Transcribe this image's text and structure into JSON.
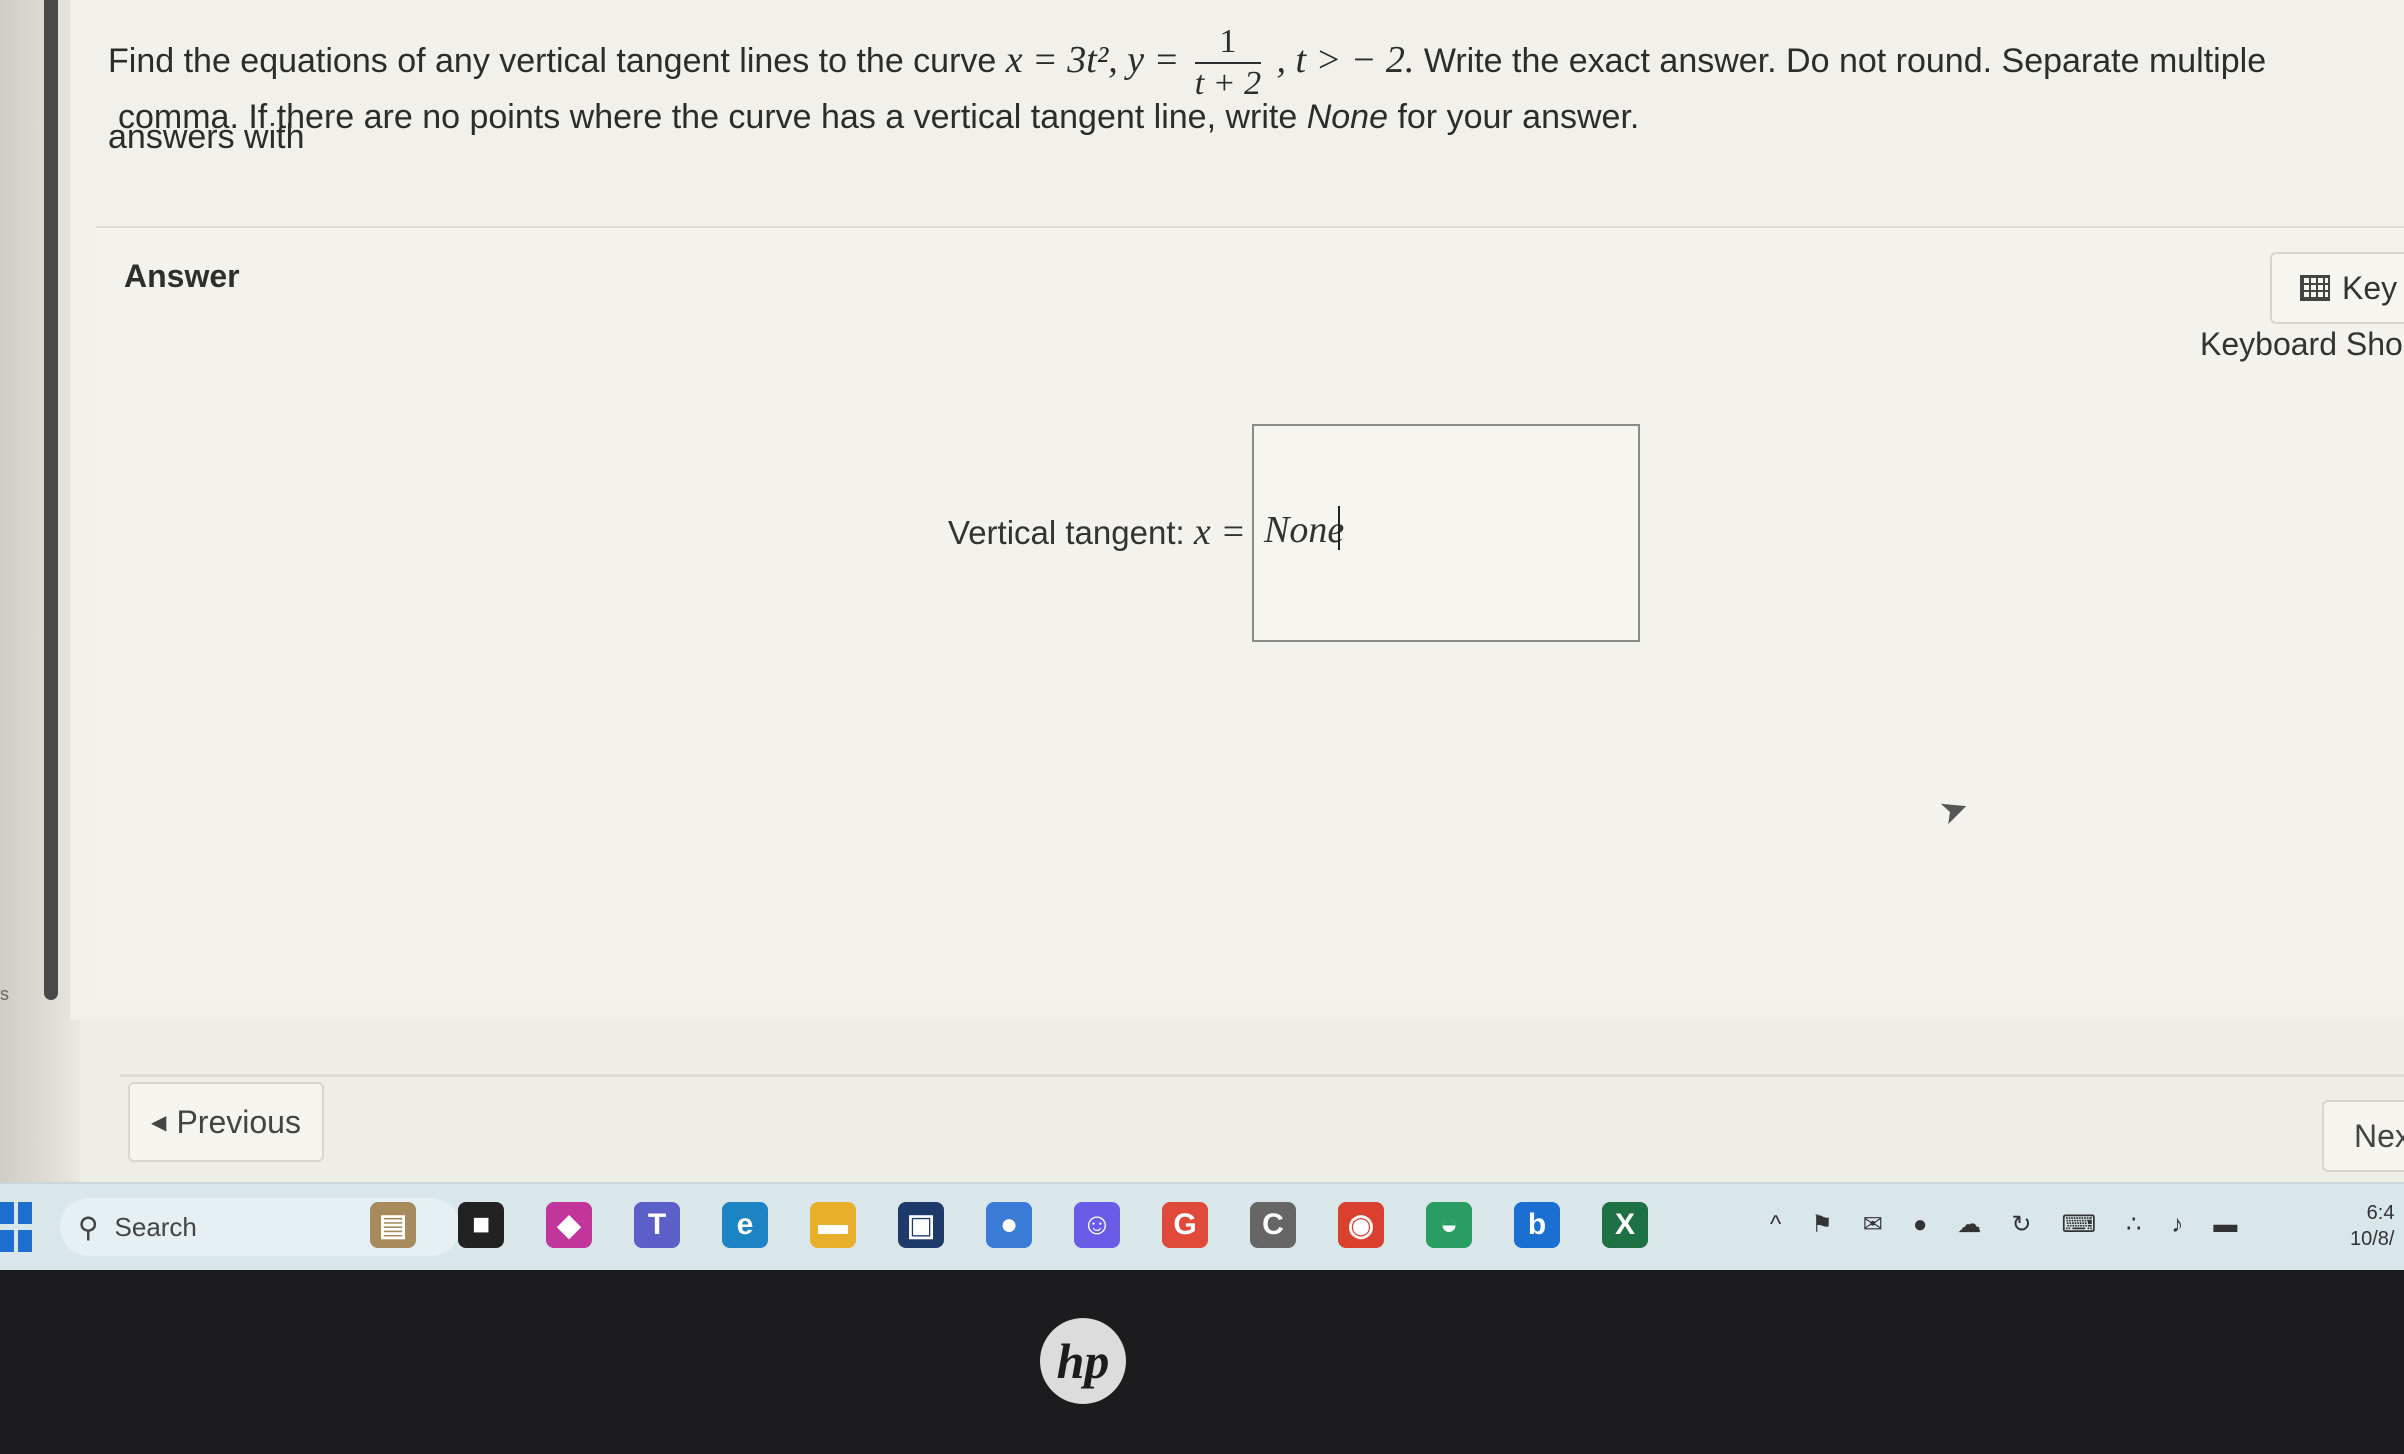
{
  "question": {
    "text_before": "Find the equations of any vertical tangent lines to the curve",
    "x_expr": "x = 3t², y =",
    "fraction_numerator": "1",
    "fraction_denominator": "t + 2",
    "condition": ", t > − 2.",
    "text_after": "Write the exact answer. Do not round. Separate multiple answers with",
    "line2": "comma. If there are no points where the curve has a vertical tangent line, write",
    "line2_emph": "None",
    "line2_end": "for your answer."
  },
  "answer": {
    "label": "Answer",
    "keypad_label": "Key",
    "keyboard_shortcuts": "Keyboard Shor",
    "vertical_tangent_label": "Vertical tangent:",
    "variable": "x =",
    "input_value": "None"
  },
  "navigation": {
    "previous": "Previous",
    "next": "Nex"
  },
  "taskbar": {
    "search_placeholder": "Search",
    "icons": [
      {
        "name": "widgets-icon",
        "glyph": "▤",
        "color": "#a88b5c"
      },
      {
        "name": "task-view-icon",
        "glyph": "■",
        "color": "#222222"
      },
      {
        "name": "copilot-icon",
        "glyph": "◆",
        "color": "#c2359b"
      },
      {
        "name": "teams-icon",
        "glyph": "T",
        "color": "#5b5fc7"
      },
      {
        "name": "edge-icon",
        "glyph": "e",
        "color": "#1d84c4"
      },
      {
        "name": "file-explorer-icon",
        "glyph": "▬",
        "color": "#e8b02a"
      },
      {
        "name": "store-icon",
        "glyph": "▣",
        "color": "#1e3a6a"
      },
      {
        "name": "copilot-app-icon",
        "glyph": "●",
        "color": "#3a7bd5"
      },
      {
        "name": "chat-icon",
        "glyph": "☺",
        "color": "#6b5ce7"
      },
      {
        "name": "google-icon",
        "glyph": "G",
        "color": "#e04a3a"
      },
      {
        "name": "c-app-icon",
        "glyph": "C",
        "color": "#666666"
      },
      {
        "name": "chrome-icon",
        "glyph": "◉",
        "color": "#d9412e"
      },
      {
        "name": "whatsapp-icon",
        "glyph": "◒",
        "color": "#2a9d63"
      },
      {
        "name": "bing-icon",
        "glyph": "b",
        "color": "#1a6fd1"
      },
      {
        "name": "excel-icon",
        "glyph": "X",
        "color": "#1d7144"
      }
    ],
    "tray_icons": [
      "^",
      "⚑",
      "✉",
      "●",
      "☁",
      "↻",
      "⌨",
      "∴",
      "♪",
      "▬"
    ],
    "time": "6:4",
    "date": "10/8/"
  },
  "bezel_logo": "hp",
  "edge_char": "s"
}
